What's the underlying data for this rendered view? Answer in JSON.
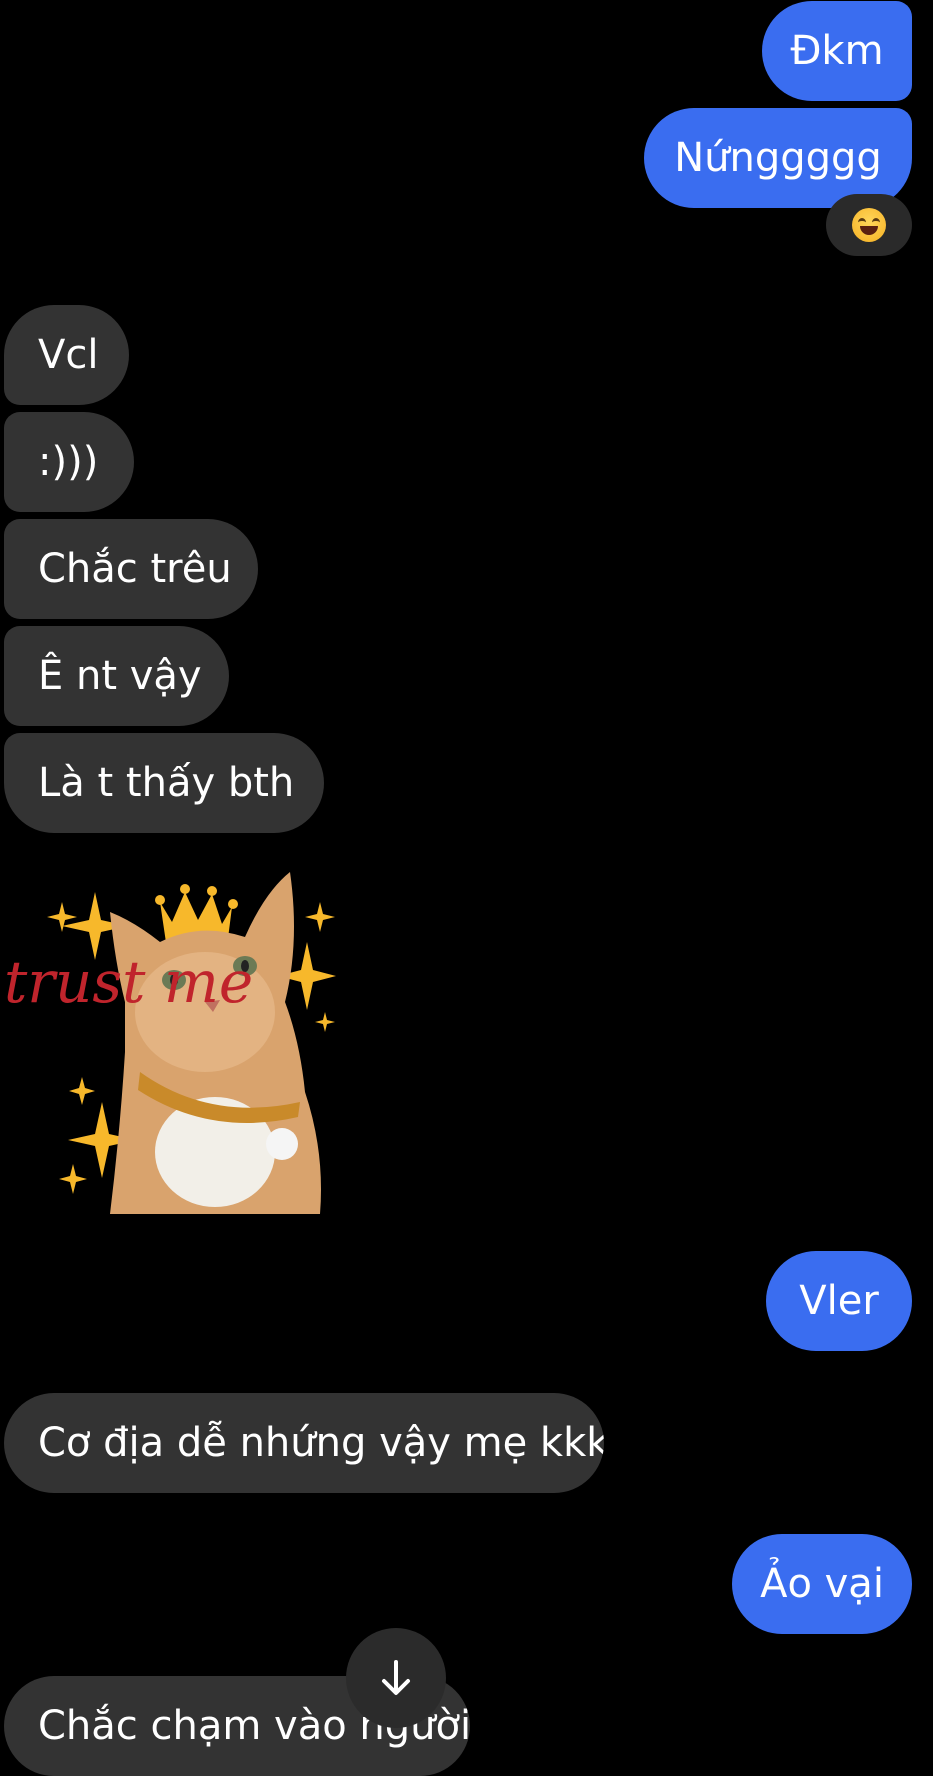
{
  "messages": {
    "out_1": "Đkm",
    "out_2": "Nứnggggg",
    "in_1": "Vcl",
    "in_2": ":)))",
    "in_3": "Chắc trêu",
    "in_4": "Ê nt vậy",
    "in_5": "Là t thấy bth",
    "out_3": "Vler",
    "in_6": "Cơ địa dễ nhứng vậy mẹ kkk",
    "out_4": "Ảo vại",
    "in_7": "Chắc chạm vào người"
  },
  "reaction": {
    "icon": "laughing-face-icon"
  },
  "sticker": {
    "text": "trust me",
    "icon": "cat-with-crown-sticker"
  },
  "scroll_button": {
    "icon": "arrow-down-icon"
  },
  "colors": {
    "background": "#000000",
    "outgoing_bubble": "#3a6df0",
    "incoming_bubble": "#333333",
    "text": "#ffffff",
    "sticker_text": "#c0242c",
    "sparkle": "#f7b82b"
  }
}
